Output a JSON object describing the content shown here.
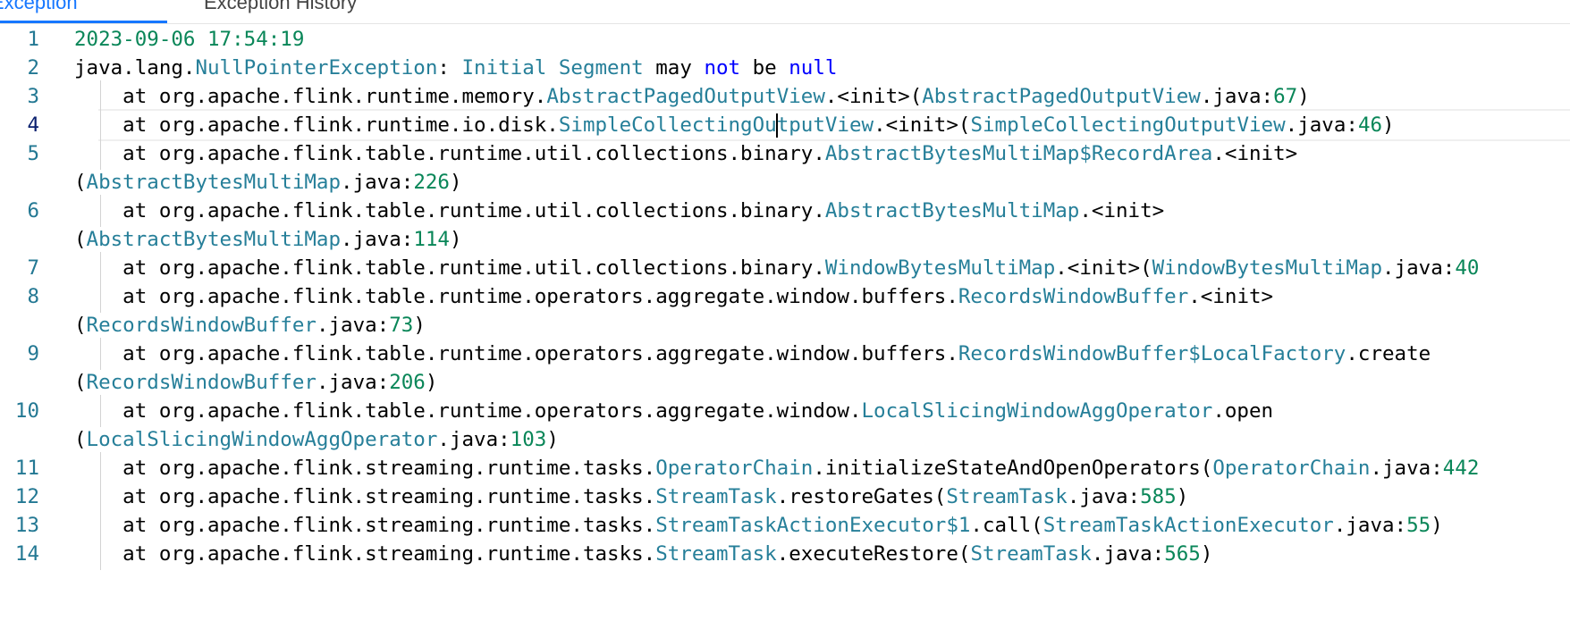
{
  "tabs": [
    {
      "label": "Exception"
    },
    {
      "label": "Exception History"
    }
  ],
  "editor": {
    "lines": [
      {
        "num": "1",
        "wrap": false,
        "indent": false,
        "parts": [
          {
            "t": "n",
            "v": "2023-09-06 17:54:19"
          }
        ]
      },
      {
        "num": "2",
        "wrap": false,
        "indent": false,
        "parts": [
          {
            "t": "p",
            "v": "java.lang."
          },
          {
            "t": "t",
            "v": "NullPointerException"
          },
          {
            "t": "p",
            "v": ": "
          },
          {
            "t": "t",
            "v": "Initial Segment"
          },
          {
            "t": "p",
            "v": " may "
          },
          {
            "t": "k",
            "v": "not"
          },
          {
            "t": "p",
            "v": " be "
          },
          {
            "t": "k",
            "v": "null"
          }
        ]
      },
      {
        "num": "3",
        "wrap": false,
        "indent": true,
        "parts": [
          {
            "t": "p",
            "v": "    at org.apache.flink.runtime.memory."
          },
          {
            "t": "t",
            "v": "AbstractPagedOutputView"
          },
          {
            "t": "p",
            "v": ".<init>("
          },
          {
            "t": "t",
            "v": "AbstractPagedOutputView"
          },
          {
            "t": "p",
            "v": ".java:"
          },
          {
            "t": "n",
            "v": "67"
          },
          {
            "t": "p",
            "v": ")"
          }
        ]
      },
      {
        "num": "4",
        "wrap": false,
        "indent": true,
        "cursor": true,
        "parts": [
          {
            "t": "p",
            "v": "    at org.apache.flink.runtime.io.disk."
          },
          {
            "t": "t",
            "v": "SimpleCollectingOu"
          },
          {
            "t": "caret",
            "v": ""
          },
          {
            "t": "t",
            "v": "tputView"
          },
          {
            "t": "p",
            "v": ".<init>("
          },
          {
            "t": "t",
            "v": "SimpleCollectingOutputView"
          },
          {
            "t": "p",
            "v": ".java:"
          },
          {
            "t": "n",
            "v": "46"
          },
          {
            "t": "p",
            "v": ")"
          }
        ]
      },
      {
        "num": "5",
        "wrap": false,
        "indent": true,
        "parts": [
          {
            "t": "p",
            "v": "    at org.apache.flink.table.runtime.util.collections.binary."
          },
          {
            "t": "t",
            "v": "AbstractBytesMultiMap$RecordArea"
          },
          {
            "t": "p",
            "v": ".<init>"
          }
        ]
      },
      {
        "num": "",
        "wrap": true,
        "indent": false,
        "parts": [
          {
            "t": "p",
            "v": "("
          },
          {
            "t": "t",
            "v": "AbstractBytesMultiMap"
          },
          {
            "t": "p",
            "v": ".java:"
          },
          {
            "t": "n",
            "v": "226"
          },
          {
            "t": "p",
            "v": ")"
          }
        ]
      },
      {
        "num": "6",
        "wrap": false,
        "indent": true,
        "parts": [
          {
            "t": "p",
            "v": "    at org.apache.flink.table.runtime.util.collections.binary."
          },
          {
            "t": "t",
            "v": "AbstractBytesMultiMap"
          },
          {
            "t": "p",
            "v": ".<init>"
          }
        ]
      },
      {
        "num": "",
        "wrap": true,
        "indent": false,
        "parts": [
          {
            "t": "p",
            "v": "("
          },
          {
            "t": "t",
            "v": "AbstractBytesMultiMap"
          },
          {
            "t": "p",
            "v": ".java:"
          },
          {
            "t": "n",
            "v": "114"
          },
          {
            "t": "p",
            "v": ")"
          }
        ]
      },
      {
        "num": "7",
        "wrap": false,
        "indent": true,
        "parts": [
          {
            "t": "p",
            "v": "    at org.apache.flink.table.runtime.util.collections.binary."
          },
          {
            "t": "t",
            "v": "WindowBytesMultiMap"
          },
          {
            "t": "p",
            "v": ".<init>("
          },
          {
            "t": "t",
            "v": "WindowBytesMultiMap"
          },
          {
            "t": "p",
            "v": ".java:"
          },
          {
            "t": "n",
            "v": "40"
          }
        ]
      },
      {
        "num": "8",
        "wrap": false,
        "indent": true,
        "parts": [
          {
            "t": "p",
            "v": "    at org.apache.flink.table.runtime.operators.aggregate.window.buffers."
          },
          {
            "t": "t",
            "v": "RecordsWindowBuffer"
          },
          {
            "t": "p",
            "v": ".<init>"
          }
        ]
      },
      {
        "num": "",
        "wrap": true,
        "indent": false,
        "parts": [
          {
            "t": "p",
            "v": "("
          },
          {
            "t": "t",
            "v": "RecordsWindowBuffer"
          },
          {
            "t": "p",
            "v": ".java:"
          },
          {
            "t": "n",
            "v": "73"
          },
          {
            "t": "p",
            "v": ")"
          }
        ]
      },
      {
        "num": "9",
        "wrap": false,
        "indent": true,
        "parts": [
          {
            "t": "p",
            "v": "    at org.apache.flink.table.runtime.operators.aggregate.window.buffers."
          },
          {
            "t": "t",
            "v": "RecordsWindowBuffer$LocalFactory"
          },
          {
            "t": "p",
            "v": ".create"
          }
        ]
      },
      {
        "num": "",
        "wrap": true,
        "indent": false,
        "parts": [
          {
            "t": "p",
            "v": "("
          },
          {
            "t": "t",
            "v": "RecordsWindowBuffer"
          },
          {
            "t": "p",
            "v": ".java:"
          },
          {
            "t": "n",
            "v": "206"
          },
          {
            "t": "p",
            "v": ")"
          }
        ]
      },
      {
        "num": "10",
        "wrap": false,
        "indent": true,
        "parts": [
          {
            "t": "p",
            "v": "    at org.apache.flink.table.runtime.operators.aggregate.window."
          },
          {
            "t": "t",
            "v": "LocalSlicingWindowAggOperator"
          },
          {
            "t": "p",
            "v": ".open"
          }
        ]
      },
      {
        "num": "",
        "wrap": true,
        "indent": false,
        "parts": [
          {
            "t": "p",
            "v": "("
          },
          {
            "t": "t",
            "v": "LocalSlicingWindowAggOperator"
          },
          {
            "t": "p",
            "v": ".java:"
          },
          {
            "t": "n",
            "v": "103"
          },
          {
            "t": "p",
            "v": ")"
          }
        ]
      },
      {
        "num": "11",
        "wrap": false,
        "indent": true,
        "parts": [
          {
            "t": "p",
            "v": "    at org.apache.flink.streaming.runtime.tasks."
          },
          {
            "t": "t",
            "v": "OperatorChain"
          },
          {
            "t": "p",
            "v": ".initializeStateAndOpenOperators("
          },
          {
            "t": "t",
            "v": "OperatorChain"
          },
          {
            "t": "p",
            "v": ".java:"
          },
          {
            "t": "n",
            "v": "442"
          }
        ]
      },
      {
        "num": "12",
        "wrap": false,
        "indent": true,
        "parts": [
          {
            "t": "p",
            "v": "    at org.apache.flink.streaming.runtime.tasks."
          },
          {
            "t": "t",
            "v": "StreamTask"
          },
          {
            "t": "p",
            "v": ".restoreGates("
          },
          {
            "t": "t",
            "v": "StreamTask"
          },
          {
            "t": "p",
            "v": ".java:"
          },
          {
            "t": "n",
            "v": "585"
          },
          {
            "t": "p",
            "v": ")"
          }
        ]
      },
      {
        "num": "13",
        "wrap": false,
        "indent": true,
        "parts": [
          {
            "t": "p",
            "v": "    at org.apache.flink.streaming.runtime.tasks."
          },
          {
            "t": "t",
            "v": "StreamTaskActionExecutor$1"
          },
          {
            "t": "p",
            "v": ".call("
          },
          {
            "t": "t",
            "v": "StreamTaskActionExecutor"
          },
          {
            "t": "p",
            "v": ".java:"
          },
          {
            "t": "n",
            "v": "55"
          },
          {
            "t": "p",
            "v": ")"
          }
        ]
      },
      {
        "num": "14",
        "wrap": false,
        "indent": true,
        "parts": [
          {
            "t": "p",
            "v": "    at org.apache.flink.streaming.runtime.tasks."
          },
          {
            "t": "t",
            "v": "StreamTask"
          },
          {
            "t": "p",
            "v": ".executeRestore("
          },
          {
            "t": "t",
            "v": "StreamTask"
          },
          {
            "t": "p",
            "v": ".java:"
          },
          {
            "t": "n",
            "v": "565"
          },
          {
            "t": "p",
            "v": ")"
          }
        ]
      }
    ]
  }
}
